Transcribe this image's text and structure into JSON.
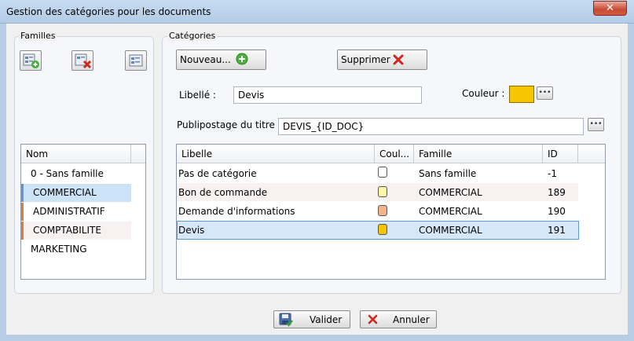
{
  "window": {
    "title": "Gestion des catégories pour les documents",
    "close_glyph": "✕"
  },
  "familles": {
    "group_label": "Familles",
    "header": "Nom",
    "items": [
      "0 - Sans famille",
      "COMMERCIAL",
      "ADMINISTRATIF",
      "COMPTABILITE",
      "MARKETING"
    ]
  },
  "categories": {
    "group_label": "Catégories",
    "new_label": "Nouveau...",
    "delete_label": "Supprimer",
    "libelle_label": "Libellé :",
    "libelle_value": "Devis",
    "couleur_label": "Couleur :",
    "couleur_value": "#f7c500",
    "publipostage_label": "Publipostage du titre :",
    "publipostage_value": "DEVIS_{ID_DOC}",
    "ellipsis": "•••",
    "table": {
      "columns": [
        "Libelle",
        "Coul...",
        "Famille",
        "ID"
      ],
      "rows": [
        {
          "libelle": "Pas de catégorie",
          "color": "#ffffff",
          "famille": "Sans famille",
          "id": "-1"
        },
        {
          "libelle": "Bon de commande",
          "color": "#fff7a8",
          "famille": "COMMERCIAL",
          "id": "189"
        },
        {
          "libelle": "Demande d'informations",
          "color": "#f3b58a",
          "famille": "COMMERCIAL",
          "id": "190"
        },
        {
          "libelle": "Devis",
          "color": "#f7c500",
          "famille": "COMMERCIAL",
          "id": "191"
        }
      ]
    }
  },
  "footer": {
    "validate_label": "Valider",
    "cancel_label": "Annuler"
  }
}
